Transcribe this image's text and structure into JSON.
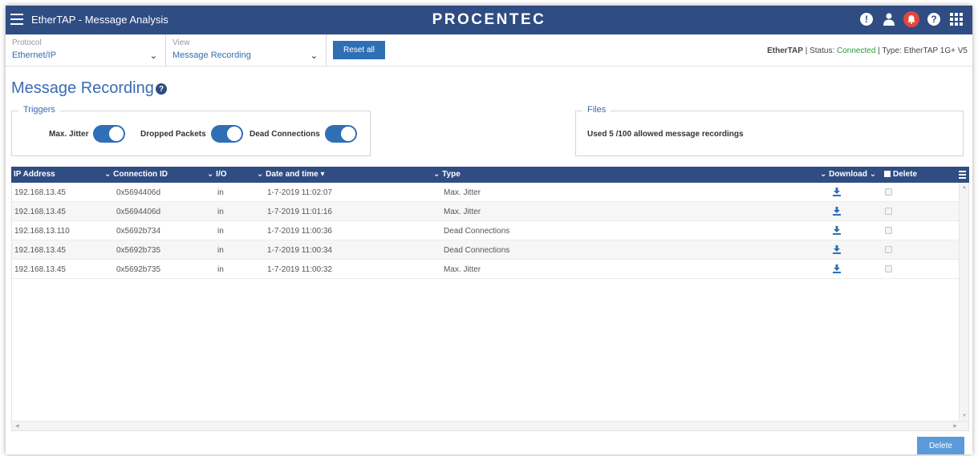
{
  "header": {
    "app_title": "EtherTAP - Message Analysis",
    "brand": "PROCENTEC",
    "icons": [
      "alert-icon",
      "user-icon",
      "bell-icon",
      "help-icon",
      "apps-grid-icon"
    ],
    "colors": {
      "bar": "#2f4c83",
      "bell": "#e2473b"
    }
  },
  "toolbar": {
    "protocol": {
      "label": "Protocol",
      "value": "Ethernet/IP"
    },
    "view": {
      "label": "View",
      "value": "Message Recording"
    },
    "reset_label": "Reset all",
    "device_name": "EtherTAP",
    "status_prefix": " | Status: ",
    "status_value": "Connected",
    "type_text": " | Type: EtherTAP 1G+ V5",
    "colors": {
      "accent": "#2f6fb5",
      "connected": "#2a9a3a"
    }
  },
  "page": {
    "title": "Message Recording"
  },
  "triggers": {
    "legend": "Triggers",
    "items": [
      {
        "label": "Max. Jitter",
        "enabled": true
      },
      {
        "label": "Dropped Packets",
        "enabled": true
      },
      {
        "label": "Dead Connections",
        "enabled": true
      }
    ]
  },
  "files": {
    "legend": "Files",
    "text": "Used 5 /100 allowed message recordings"
  },
  "table": {
    "columns": {
      "ip": "IP Address",
      "conn": "Connection ID",
      "io": "I/O",
      "date": "Date and time",
      "type": "Type",
      "download": "Download",
      "delete": "Delete"
    },
    "rows": [
      {
        "ip": "192.168.13.45",
        "conn": "0x5694406d",
        "io": "in",
        "date": "1-7-2019 11:02:07",
        "type": "Max. Jitter"
      },
      {
        "ip": "192.168.13.45",
        "conn": "0x5694406d",
        "io": "in",
        "date": "1-7-2019 11:01:16",
        "type": "Max. Jitter"
      },
      {
        "ip": "192.168.13.110",
        "conn": "0x5692b734",
        "io": "in",
        "date": "1-7-2019 11:00:36",
        "type": "Dead Connections"
      },
      {
        "ip": "192.168.13.45",
        "conn": "0x5692b735",
        "io": "in",
        "date": "1-7-2019 11:00:34",
        "type": "Dead Connections"
      },
      {
        "ip": "192.168.13.45",
        "conn": "0x5692b735",
        "io": "in",
        "date": "1-7-2019 11:00:32",
        "type": "Max. Jitter"
      }
    ]
  },
  "footer": {
    "delete_label": "Delete"
  }
}
